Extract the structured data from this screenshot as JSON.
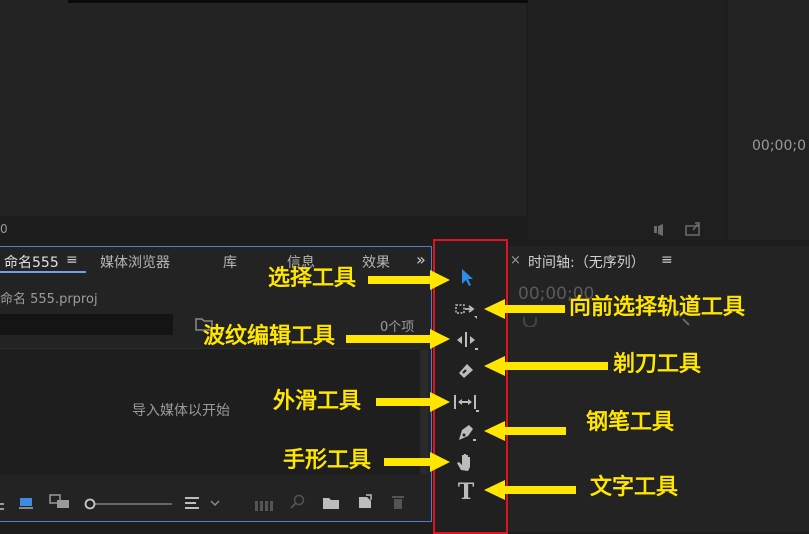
{
  "program_monitor": {
    "timecode": "00;00;0",
    "left_num": "0"
  },
  "project_panel": {
    "tabs": [
      "命名555",
      "媒体浏览器",
      "库",
      "信息",
      "效果"
    ],
    "menu_glyph": "≡",
    "overflow_glyph": "»",
    "project_file": "命名 555.prproj",
    "item_count": "0个项",
    "empty_message": "导入媒体以开始"
  },
  "timeline_panel": {
    "close_glyph": "×",
    "title": "时间轴:（无序列）",
    "menu_glyph": "≡",
    "timecode": "00;00;00"
  },
  "tools": [
    {
      "name": "selection-tool-icon"
    },
    {
      "name": "track-select-forward-tool-icon"
    },
    {
      "name": "ripple-edit-tool-icon"
    },
    {
      "name": "razor-tool-icon"
    },
    {
      "name": "slip-tool-icon"
    },
    {
      "name": "pen-tool-icon"
    },
    {
      "name": "hand-tool-icon"
    },
    {
      "name": "type-tool-icon",
      "glyph": "T"
    }
  ],
  "callouts": {
    "selection": "选择工具",
    "track_select_forward": "向前选择轨道工具",
    "ripple_edit": "波纹编辑工具",
    "razor": "剃刀工具",
    "slip": "外滑工具",
    "pen": "钢笔工具",
    "hand": "手形工具",
    "type": "文字工具"
  },
  "colors": {
    "annotation_yellow": "#ffe600",
    "highlight_red": "#e0141e",
    "focus_blue": "#4a7fd1",
    "tool_active": "#2d8ceb"
  }
}
